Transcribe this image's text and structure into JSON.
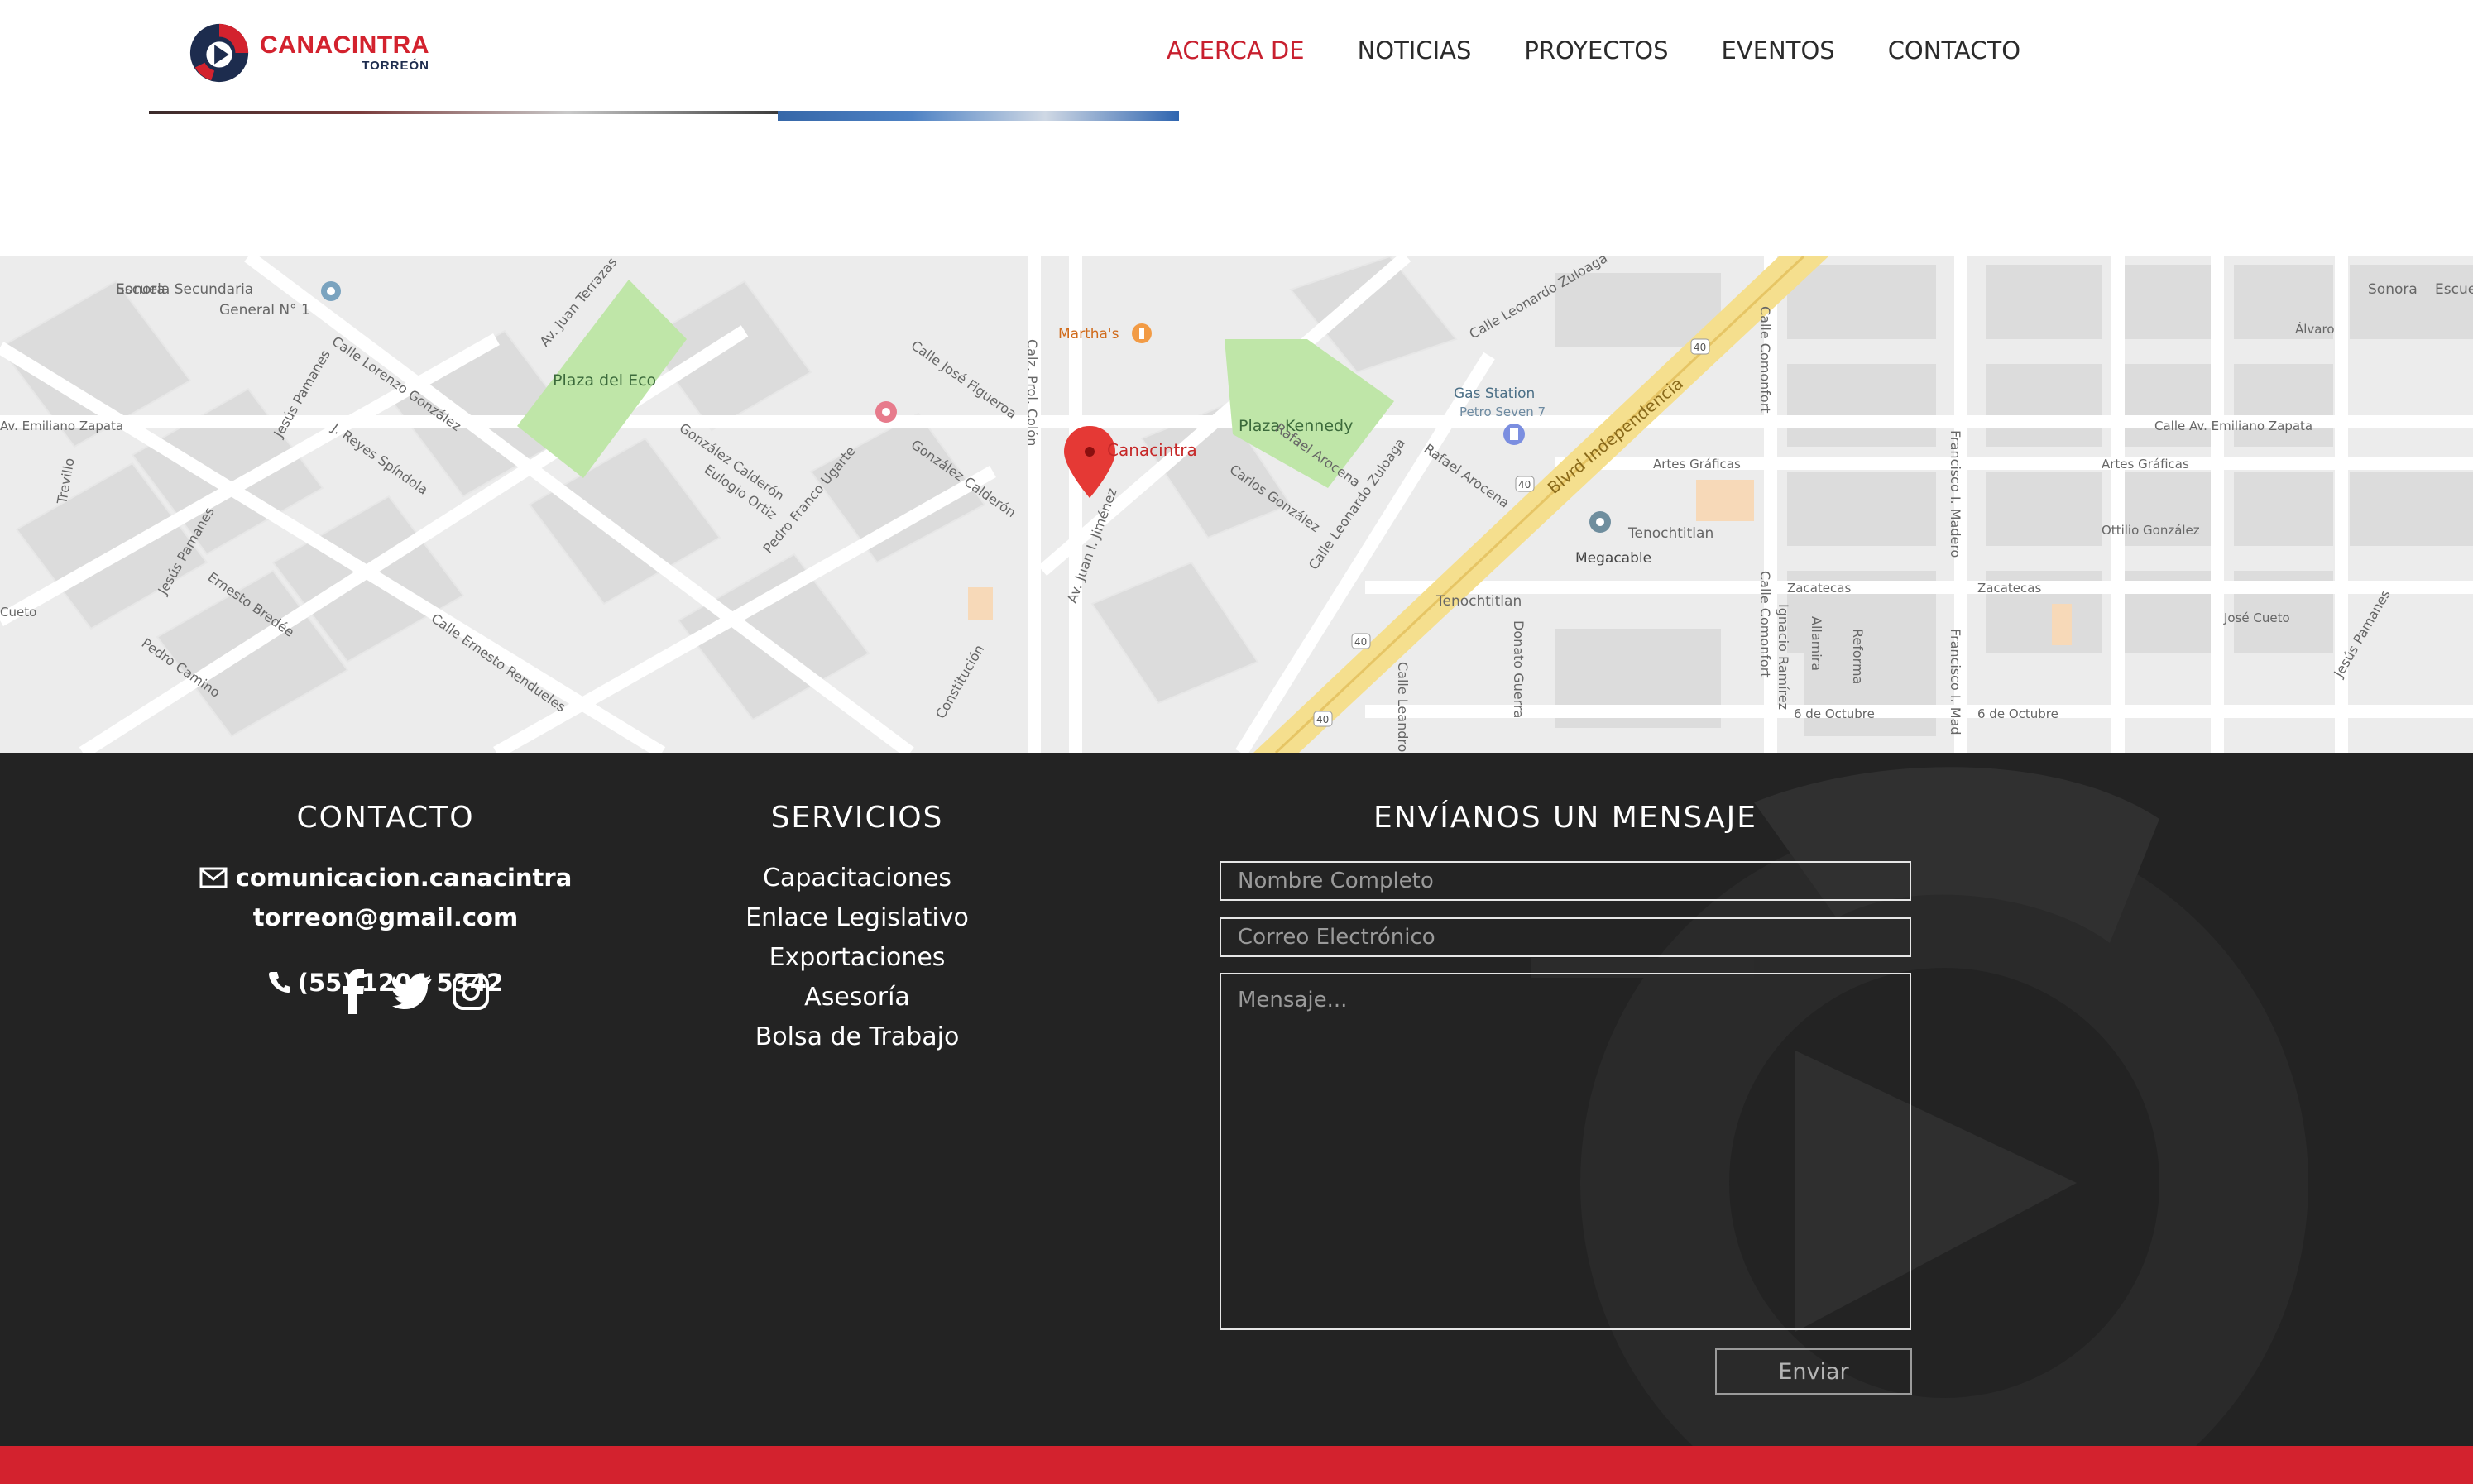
{
  "brand": {
    "name": "CANACINTRA",
    "sub": "TORREÓN"
  },
  "nav": [
    {
      "label": "ACERCA DE",
      "active": true
    },
    {
      "label": "NOTICIAS"
    },
    {
      "label": "PROYECTOS"
    },
    {
      "label": "EVENTOS"
    },
    {
      "label": "CONTACTO"
    }
  ],
  "map": {
    "marker_label": "Canacintra",
    "places": [
      "Escuela Secundaria",
      "General N° 1",
      "Plaza del Eco",
      "Plaza Kennedy",
      "Martha's",
      "Gas Station",
      "Petro Seven 7",
      "Megacable",
      "Blvrd Independencia",
      "Sonora",
      "Escuela",
      "Tenochtitlan",
      "Artes Gráficas",
      "Zacatecas",
      "6 de Octubre",
      "Calle Comonfort",
      "Francisco I. Madero",
      "Calz. Prol. Colón",
      "Álvaro",
      "Calle Av. Emiliano Zapata",
      "Av. Emiliano Zapata",
      "Jesús Pamanes",
      "Ottilio González",
      "José Cueto",
      "Rafael Arocena",
      "Carlos González",
      "Calle Lorenzo González",
      "J. Reyes Spíndola",
      "Eulogio Ortiz",
      "Pedro Franco Ugarte",
      "González Calderón",
      "Calle José Figueroa",
      "Av. Juan Terrazas",
      "Constitución",
      "Av. Juan I. Jiménez",
      "Calle Leonardo Zuloaga",
      "Donato Guerra",
      "Reforma",
      "Allamira",
      "Ignacio Ramírez",
      "Calle Leandro",
      "Ernesto Bredée",
      "Pedro Camino",
      "Trevillo",
      "Calle Ernesto Rendueles"
    ],
    "colors": {
      "park": "#bfe6a8",
      "highway": "#f5df8e",
      "water_pin": "#5b8ca8"
    }
  },
  "footer": {
    "contact": {
      "title": "CONTACTO",
      "email_line1": "comunicacion.canacintra",
      "email_line2": "torreon@gmail.com",
      "phone": "(55) 1204 5342",
      "social": [
        "facebook-icon",
        "twitter-icon",
        "instagram-icon"
      ]
    },
    "services": {
      "title": "SERVICIOS",
      "items": [
        "Capacitaciones",
        "Enlace Legislativo",
        "Exportaciones",
        "Asesoría",
        "Bolsa de Trabajo"
      ]
    },
    "form": {
      "title": "ENVÍANOS UN MENSAJE",
      "name_placeholder": "Nombre Completo",
      "email_placeholder": "Correo Electrónico",
      "message_placeholder": "Mensaje...",
      "submit_label": "Enviar"
    }
  },
  "colors": {
    "brand_red": "#d3222e",
    "footer_bg": "#232323",
    "navy": "#1d2c4e"
  }
}
